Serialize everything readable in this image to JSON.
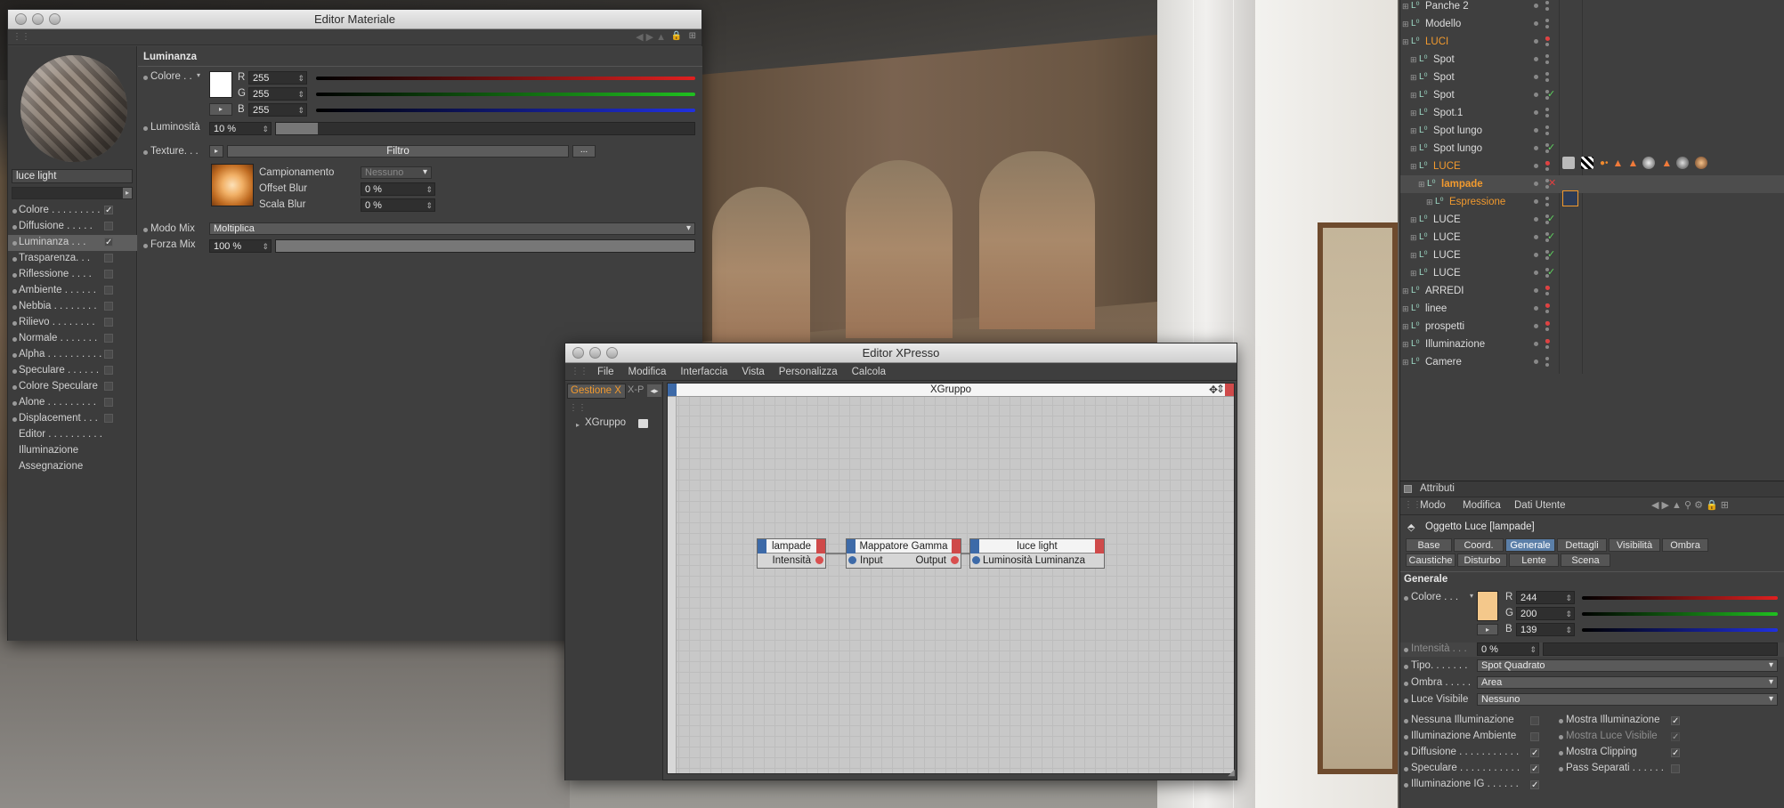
{
  "material_editor": {
    "title": "Editor Materiale",
    "material_name": "luce light",
    "channels": [
      {
        "label": "Colore . . . . . . . . .",
        "checked": true,
        "active": false
      },
      {
        "label": "Diffusione . . . . .",
        "checked": false,
        "active": false
      },
      {
        "label": "Luminanza . . .",
        "checked": true,
        "active": true
      },
      {
        "label": "Trasparenza. . .",
        "checked": false,
        "active": false
      },
      {
        "label": "Riflessione . . . .",
        "checked": false,
        "active": false
      },
      {
        "label": "Ambiente . . . . . .",
        "checked": false,
        "active": false
      },
      {
        "label": "Nebbia . . . . . . . .",
        "checked": false,
        "active": false
      },
      {
        "label": "Rilievo . . . . . . . .",
        "checked": false,
        "active": false
      },
      {
        "label": "Normale . . . . . . .",
        "checked": false,
        "active": false
      },
      {
        "label": "Alpha . . . . . . . . . .",
        "checked": false,
        "active": false
      },
      {
        "label": "Speculare . . . . . .",
        "checked": false,
        "active": false
      },
      {
        "label": "Colore Speculare",
        "checked": false,
        "active": false
      },
      {
        "label": "Alone . . . . . . . . .",
        "checked": false,
        "active": false
      },
      {
        "label": "Displacement . . .",
        "checked": false,
        "active": false
      },
      {
        "label": "Editor . . . . . . . . . .",
        "checked": null,
        "active": false
      },
      {
        "label": "Illuminazione",
        "checked": null,
        "active": false
      },
      {
        "label": "Assegnazione",
        "checked": null,
        "active": false
      }
    ],
    "section": "Luminanza",
    "color_label": "Colore . .",
    "r_label": "R",
    "g_label": "G",
    "b_label": "B",
    "r": "255",
    "g": "255",
    "b": "255",
    "brightness_label": "Luminosità",
    "brightness": "10 %",
    "brightness_level": 0.1,
    "texture_label": "Texture. . .",
    "texture_button": "Filtro",
    "more_button": "...",
    "sampling_label": "Campionamento",
    "sampling_value": "Nessuno",
    "offset_label": "Offset Blur",
    "offset_value": "0 %",
    "scale_label": "Scala Blur",
    "scale_value": "0 %",
    "mix_mode_label": "Modo Mix",
    "mix_mode_value": "Moltiplica",
    "mix_strength_label": "Forza Mix",
    "mix_strength_value": "100 %",
    "mix_strength_level": 1.0
  },
  "xpresso": {
    "title": "Editor XPresso",
    "menu": [
      "File",
      "Modifica",
      "Interfaccia",
      "Vista",
      "Personalizza",
      "Calcola"
    ],
    "side_tabs": [
      "Gestione X",
      "X-P"
    ],
    "tree_item": "XGruppo",
    "canvas_title": "XGruppo",
    "nodes": [
      {
        "title": "lampade",
        "out_port": "Intensità"
      },
      {
        "title": "Mappatore Gamma",
        "in_port": "Input",
        "out_port": "Output"
      },
      {
        "title": "luce light",
        "in_port": "Luminosità Luminanza"
      }
    ]
  },
  "object_manager": {
    "rows": [
      {
        "name": "Panche 2",
        "indent": 0,
        "orange": false
      },
      {
        "name": "Modello",
        "indent": 0,
        "orange": false
      },
      {
        "name": "LUCI",
        "indent": 0,
        "orange": true
      },
      {
        "name": "Spot",
        "indent": 1,
        "orange": false
      },
      {
        "name": "Spot",
        "indent": 1,
        "orange": false
      },
      {
        "name": "Spot",
        "indent": 1,
        "orange": false
      },
      {
        "name": "Spot.1",
        "indent": 1,
        "orange": false
      },
      {
        "name": "Spot lungo",
        "indent": 1,
        "orange": false
      },
      {
        "name": "Spot lungo",
        "indent": 1,
        "orange": false
      },
      {
        "name": "LUCE",
        "indent": 1,
        "orange": true
      },
      {
        "name": "lampade",
        "indent": 2,
        "orange": true
      },
      {
        "name": "Espressione",
        "indent": 3,
        "orange": true
      },
      {
        "name": "LUCE",
        "indent": 1,
        "orange": false
      },
      {
        "name": "LUCE",
        "indent": 1,
        "orange": false
      },
      {
        "name": "LUCE",
        "indent": 1,
        "orange": false
      },
      {
        "name": "LUCE",
        "indent": 1,
        "orange": false
      },
      {
        "name": "ARREDI",
        "indent": 0,
        "orange": false
      },
      {
        "name": "linee",
        "indent": 0,
        "orange": false
      },
      {
        "name": "prospetti",
        "indent": 0,
        "orange": false
      },
      {
        "name": "Illuminazione",
        "indent": 0,
        "orange": false
      },
      {
        "name": "Camere",
        "indent": 0,
        "orange": false
      }
    ]
  },
  "attributes": {
    "title": "Attributi",
    "menu": [
      "Modo",
      "Modifica",
      "Dati Utente"
    ],
    "object_label": "Oggetto Luce [lampade]",
    "tabs_row1": [
      "Base",
      "Coord.",
      "Generale",
      "Dettagli",
      "Visibilità",
      "Ombra"
    ],
    "tabs_row2": [
      "Caustiche",
      "Disturbo",
      "Lente",
      "Scena"
    ],
    "active_tab": "Generale",
    "section": "Generale",
    "color_label": "Colore . . .",
    "r": "244",
    "g": "200",
    "b": "139",
    "r_label": "R",
    "g_label": "G",
    "b_label": "B",
    "light_color": "#f4c88b",
    "intensity_label": "Intensità . . .",
    "intensity": "0 %",
    "type_label": "Tipo. . . . . . .",
    "type_value": "Spot Quadrato",
    "shadow_label": "Ombra . . . . .",
    "shadow_value": "Area",
    "visible_label": "Luce Visibile",
    "visible_value": "Nessuno",
    "checks_left": [
      {
        "label": "Nessuna Illuminazione",
        "checked": false
      },
      {
        "label": "Illuminazione Ambiente",
        "checked": false
      },
      {
        "label": "Diffusione . . . . . . . . . . .",
        "checked": true
      },
      {
        "label": "Speculare . . . . . . . . . . .",
        "checked": true
      },
      {
        "label": "Illuminazione IG . . . . . .",
        "checked": true
      }
    ],
    "checks_right": [
      {
        "label": "Mostra Illuminazione",
        "checked": true,
        "dim": false
      },
      {
        "label": "Mostra Luce Visibile",
        "checked": true,
        "dim": true
      },
      {
        "label": "Mostra Clipping",
        "checked": true,
        "dim": false
      },
      {
        "label": "Pass Separati . . . . . .",
        "checked": false,
        "dim": false
      }
    ]
  }
}
